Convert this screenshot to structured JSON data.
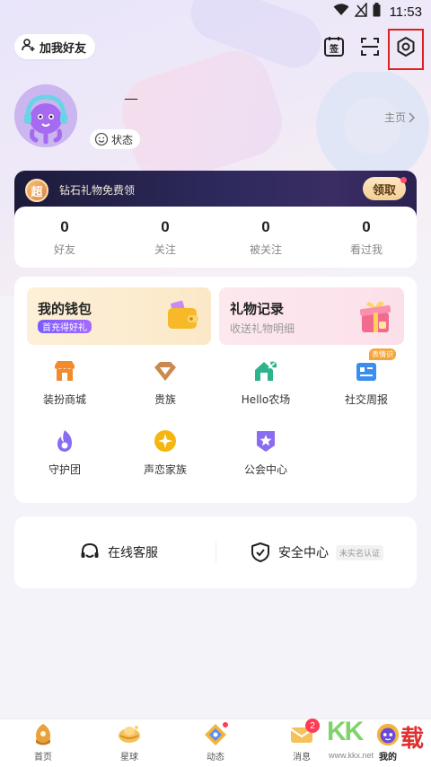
{
  "status_bar": {
    "time": "11:53"
  },
  "header": {
    "add_friend_label": "加我好友",
    "sign_in_glyph": "签"
  },
  "profile": {
    "nickname": "—",
    "status_label": "状态",
    "homepage_label": "主页"
  },
  "banner": {
    "super_glyph": "超",
    "text": "钻石礼物免费领",
    "claim_label": "领取"
  },
  "stats": [
    {
      "value": "0",
      "label": "好友"
    },
    {
      "value": "0",
      "label": "关注"
    },
    {
      "value": "0",
      "label": "被关注"
    },
    {
      "value": "0",
      "label": "看过我"
    }
  ],
  "wallet": {
    "title": "我的钱包",
    "tag": "首充得好礼"
  },
  "gift_record": {
    "title": "礼物记录",
    "subtitle": "收送礼物明细"
  },
  "features": [
    {
      "label": "装扮商城",
      "icon": "shop-icon",
      "color": "#f28a2e"
    },
    {
      "label": "贵族",
      "icon": "diamond-icon",
      "color": "#c9894f"
    },
    {
      "label": "Hello农场",
      "icon": "farm-house-icon",
      "color": "#2fb38c"
    },
    {
      "label": "社交周报",
      "icon": "weekly-report-icon",
      "color": "#3b8df0",
      "badge": "表情识"
    },
    {
      "label": "守护团",
      "icon": "guard-flame-icon",
      "color": "#8a6cf0"
    },
    {
      "label": "声恋家族",
      "icon": "family-star-icon",
      "color": "#f5b70f"
    },
    {
      "label": "公会中心",
      "icon": "guild-badge-icon",
      "color": "#8a6cf0"
    }
  ],
  "services": {
    "support_label": "在线客服",
    "security_label": "安全中心",
    "security_tag": "未实名认证"
  },
  "bottom_nav": [
    {
      "label": "首页",
      "icon": "home-icon"
    },
    {
      "label": "星球",
      "icon": "planet-icon"
    },
    {
      "label": "动态",
      "icon": "moments-icon"
    },
    {
      "label": "消息",
      "icon": "message-icon",
      "badge": "2"
    },
    {
      "label": "我的",
      "icon": "profile-icon"
    }
  ],
  "watermark": {
    "brand": "KK",
    "glyph": "载",
    "url": "www.kkx.net"
  }
}
